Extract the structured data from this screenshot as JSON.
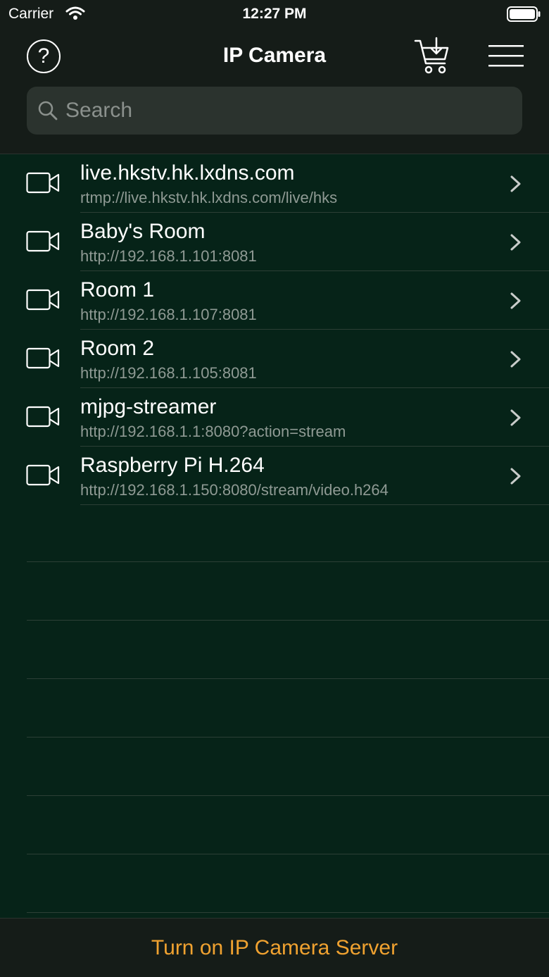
{
  "status_bar": {
    "carrier": "Carrier",
    "time": "12:27 PM"
  },
  "nav": {
    "title": "IP Camera",
    "help_glyph": "?",
    "help_icon": "question-circle-icon",
    "cart_icon": "cart-download-icon",
    "menu_icon": "hamburger-menu-icon"
  },
  "search": {
    "placeholder": "Search",
    "value": ""
  },
  "cameras": [
    {
      "title": "live.hkstv.hk.lxdns.com",
      "url": "rtmp://live.hkstv.hk.lxdns.com/live/hks"
    },
    {
      "title": "Baby's Room",
      "url": "http://192.168.1.101:8081"
    },
    {
      "title": "Room 1",
      "url": "http://192.168.1.107:8081"
    },
    {
      "title": "Room 2",
      "url": "http://192.168.1.105:8081"
    },
    {
      "title": "mjpg-streamer",
      "url": "http://192.168.1.1:8080?action=stream"
    },
    {
      "title": "Raspberry Pi H.264",
      "url": "http://192.168.1.150:8080/stream/video.h264"
    }
  ],
  "bottom": {
    "server_button": "Turn on IP Camera Server"
  },
  "colors": {
    "background": "#062318",
    "bar": "#151c18",
    "accent": "#f0a230",
    "subtitle": "#8f9a94"
  }
}
